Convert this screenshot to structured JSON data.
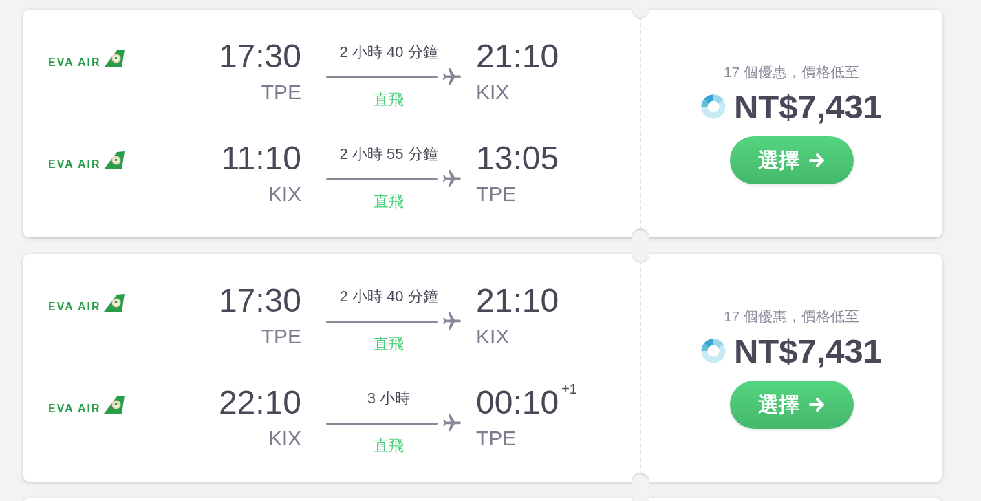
{
  "results": [
    {
      "legs": [
        {
          "airline_logo": "EVA AIR",
          "departure": {
            "time": "17:30",
            "airport": "TPE"
          },
          "duration": "2 小時 40 分鐘",
          "stops": "直飛",
          "arrival": {
            "time": "21:10",
            "airport": "KIX"
          }
        },
        {
          "airline_logo": "EVA AIR",
          "departure": {
            "time": "11:10",
            "airport": "KIX"
          },
          "duration": "2 小時 55 分鐘",
          "stops": "直飛",
          "arrival": {
            "time": "13:05",
            "airport": "TPE"
          }
        }
      ],
      "deals_text": "17 個優惠，價格低至",
      "price": "NT$7,431",
      "select_button": "選擇"
    },
    {
      "legs": [
        {
          "airline_logo": "EVA AIR",
          "departure": {
            "time": "17:30",
            "airport": "TPE"
          },
          "duration": "2 小時 40 分鐘",
          "stops": "直飛",
          "arrival": {
            "time": "21:10",
            "airport": "KIX"
          }
        },
        {
          "airline_logo": "EVA AIR",
          "departure": {
            "time": "22:10",
            "airport": "KIX"
          },
          "duration": "3 小時",
          "stops": "直飛",
          "arrival": {
            "time": "00:10",
            "airport": "TPE",
            "day_offset": "+1"
          }
        }
      ],
      "deals_text": "17 個優惠，價格低至",
      "price": "NT$7,431",
      "select_button": "選擇"
    }
  ],
  "more_results_below": true
}
